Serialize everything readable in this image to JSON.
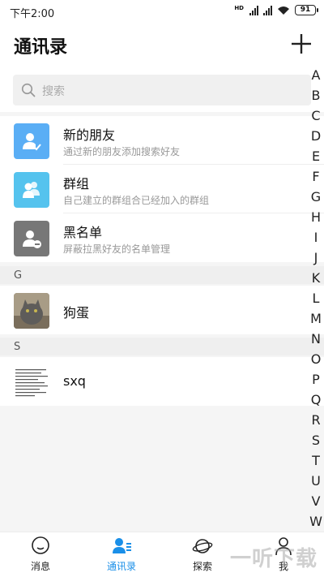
{
  "status_bar": {
    "time": "下午2:00",
    "network_label": "HD",
    "battery": "91"
  },
  "header": {
    "title": "通讯录",
    "add_icon": "plus-icon"
  },
  "search": {
    "placeholder": "搜索"
  },
  "features": [
    {
      "title": "新的朋友",
      "subtitle": "通过新的朋友添加搜索好友",
      "icon": "new-friend-icon",
      "color": "#5aaef5"
    },
    {
      "title": "群组",
      "subtitle": "自己建立的群组合已经加入的群组",
      "icon": "group-icon",
      "color": "#55c3ee"
    },
    {
      "title": "黑名单",
      "subtitle": "屏蔽拉黑好友的名单管理",
      "icon": "blacklist-icon",
      "color": "#777777"
    }
  ],
  "groups": [
    {
      "letter": "G",
      "contacts": [
        {
          "name": "狗蛋",
          "avatar": "cat-photo"
        }
      ]
    },
    {
      "letter": "S",
      "contacts": [
        {
          "name": "sxq",
          "avatar": "text-document-thumbnail"
        }
      ]
    }
  ],
  "alphabet": [
    "A",
    "B",
    "C",
    "D",
    "E",
    "F",
    "G",
    "H",
    "I",
    "J",
    "K",
    "L",
    "M",
    "N",
    "O",
    "P",
    "Q",
    "R",
    "S",
    "T",
    "U",
    "V",
    "W"
  ],
  "bottom_nav": [
    {
      "label": "消息",
      "icon": "chat-bubble-icon",
      "active": false
    },
    {
      "label": "通讯录",
      "icon": "contacts-icon",
      "active": true
    },
    {
      "label": "探索",
      "icon": "planet-icon",
      "active": false
    },
    {
      "label": "我",
      "icon": "person-icon",
      "active": false
    }
  ],
  "watermark": "一听下载",
  "colors": {
    "accent": "#1a8fe8",
    "background": "#f5f5f5"
  }
}
